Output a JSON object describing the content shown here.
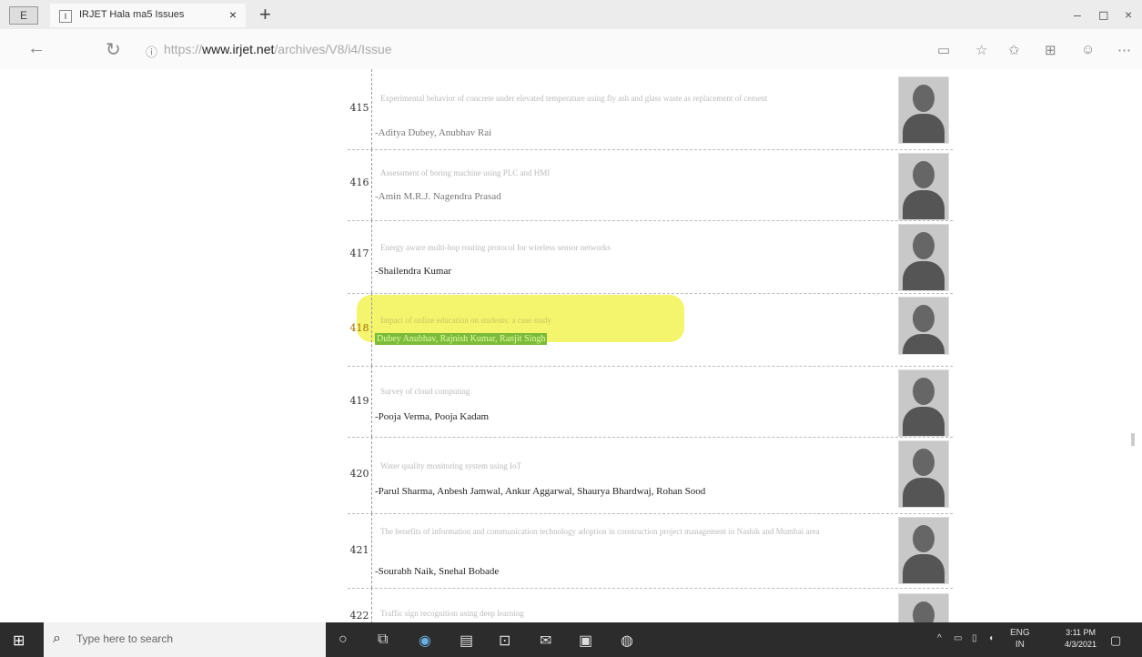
{
  "browser": {
    "menu_label": "E",
    "tab_favicon": "I",
    "tab_title": "IRJET Hala ma5 Issues",
    "tab_close": "×",
    "new_tab": "+",
    "url_prefix": "https://",
    "url_host": "www.irjet.net",
    "url_rest": "/archives/V8/i4/Issue",
    "win_minimize": "–",
    "win_maximize": "◻",
    "win_close": "×"
  },
  "rows": [
    {
      "num": "415",
      "title": "Experimental behavior of concrete under elevated temperature using fly ash and glass waste as replacement of cement",
      "authors": "-Aditya Dubey, Anubhav Rai",
      "faint": true
    },
    {
      "num": "416",
      "title": "Assessment of boring machine using PLC and HMI",
      "authors": "-Amin M.R.J. Nagendra Prasad",
      "faint": true
    },
    {
      "num": "417",
      "title": "Energy aware multi-hop routing protocol for wireless sensor networks",
      "authors": "-Shailendra Kumar",
      "faint": false
    },
    {
      "num": "418",
      "title": "Impact of online education on students: a case study",
      "authors": "Dubey Anubhav, Rajnish Kumar, Ranjit Singh",
      "faint": false
    },
    {
      "num": "419",
      "title": "Survey of cloud computing",
      "authors": "-Pooja Verma, Pooja Kadam",
      "faint": false
    },
    {
      "num": "420",
      "title": "Water quality monitoring system using IoT",
      "authors": "-Parul Sharma, Anbesh Jamwal, Ankur Aggarwal, Shaurya Bhardwaj, Rohan Sood",
      "faint": false
    },
    {
      "num": "421",
      "title": "The benefits of information and communication technology adoption in construction project management in Nashik and Mumbai area",
      "authors": "-Sourabh Naik, Snehal Bobade",
      "faint": false
    },
    {
      "num": "422",
      "title": "Traffic sign recognition using deep learning",
      "authors": "",
      "faint": false
    }
  ],
  "taskbar": {
    "search_placeholder": "Type here to search",
    "tray_lang": "ENG",
    "tray_region": "IN",
    "time": "3:11 PM",
    "date": "4/3/2021"
  }
}
